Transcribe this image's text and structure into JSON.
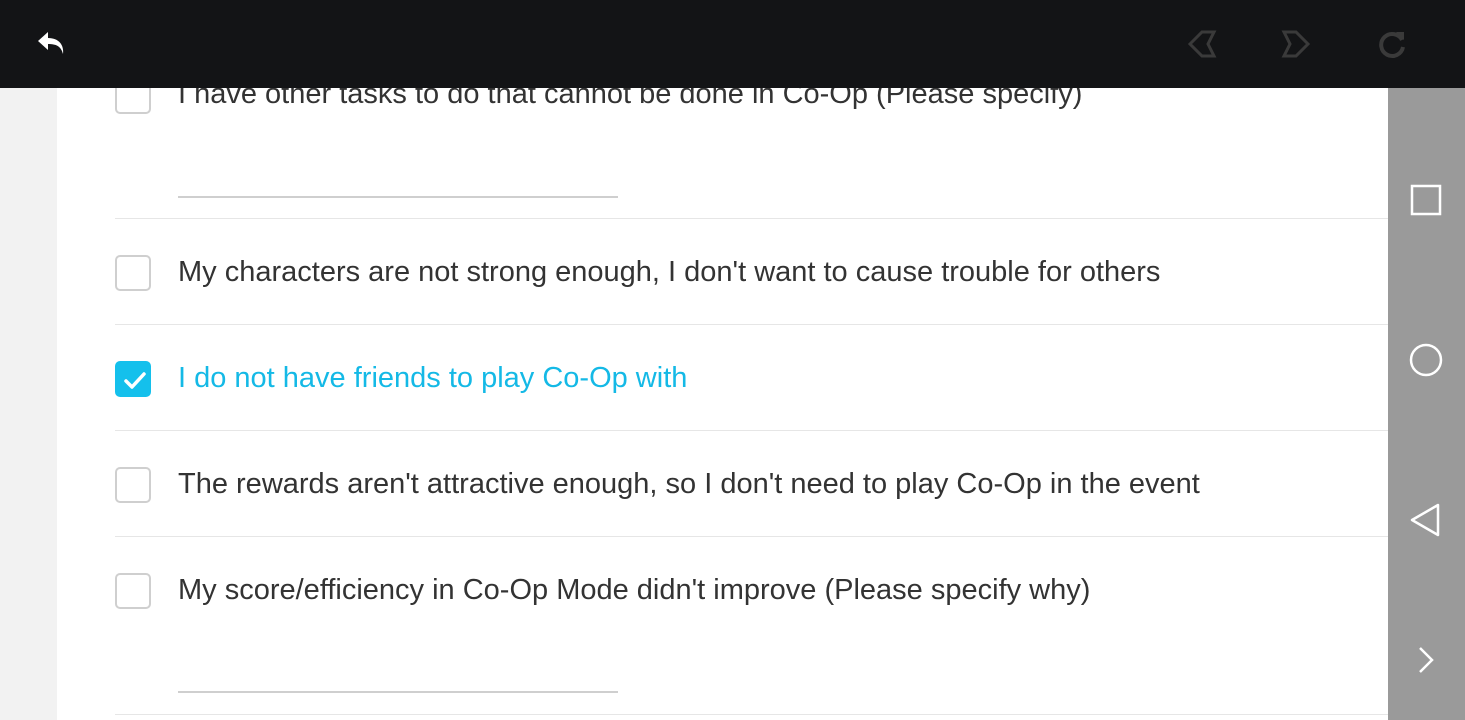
{
  "toolbar": {
    "back_icon": "back-arrow-icon",
    "prev_icon": "previous-icon",
    "next_icon": "next-icon",
    "reload_icon": "reload-icon"
  },
  "survey": {
    "options": [
      {
        "label": "I have other tasks to do that cannot be done in Co-Op (Please specify)",
        "checked": false,
        "has_specify": true
      },
      {
        "label": "My characters are not strong enough, I don't want to cause trouble for others",
        "checked": false,
        "has_specify": false
      },
      {
        "label": "I do not have friends to play Co-Op with",
        "checked": true,
        "has_specify": false
      },
      {
        "label": "The rewards aren't attractive enough, so I don't need to play Co-Op in the event",
        "checked": false,
        "has_specify": false
      },
      {
        "label": "My score/efficiency in Co-Op Mode didn't improve (Please specify why)",
        "checked": false,
        "has_specify": true
      }
    ]
  },
  "colors": {
    "accent": "#14c0ec",
    "topbar": "#131416",
    "navbar": "#9a9a9a",
    "text": "#333333"
  },
  "navbar": {
    "icons": [
      "square-icon",
      "circle-icon",
      "triangle-back-icon",
      "chevron-right-icon"
    ]
  }
}
